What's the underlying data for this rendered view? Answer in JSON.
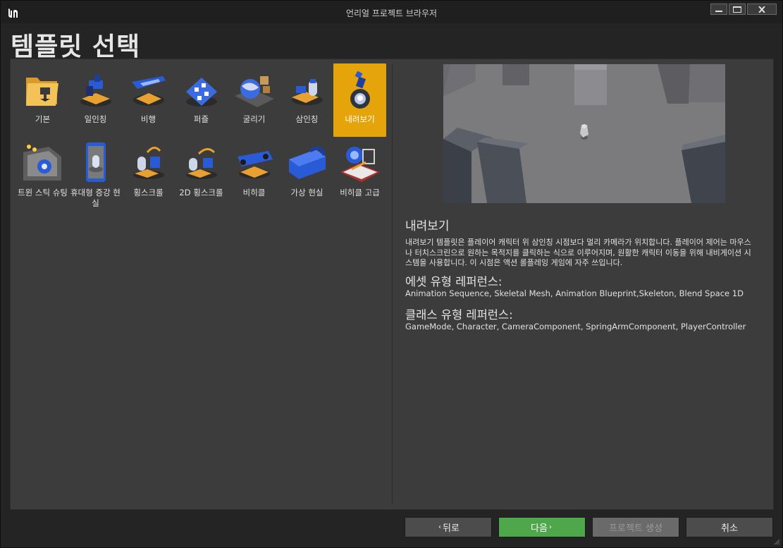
{
  "window": {
    "title": "언리얼 프로젝트 브라우저"
  },
  "heading": "템플릿 선택",
  "templates": [
    {
      "label": "기본",
      "icon": "folder-icon"
    },
    {
      "label": "일인칭",
      "icon": "first-person-icon"
    },
    {
      "label": "비행",
      "icon": "flying-icon"
    },
    {
      "label": "퍼즐",
      "icon": "puzzle-icon"
    },
    {
      "label": "굴리기",
      "icon": "rolling-icon"
    },
    {
      "label": "삼인칭",
      "icon": "third-person-icon"
    },
    {
      "label": "내려보기",
      "icon": "top-down-icon",
      "selected": true
    },
    {
      "label": "트윈 스틱 슈팅",
      "icon": "twin-stick-icon"
    },
    {
      "label": "휴대형 증강 현실",
      "icon": "handheld-ar-icon"
    },
    {
      "label": "횡스크롤",
      "icon": "side-scroller-icon"
    },
    {
      "label": "2D 횡스크롤",
      "icon": "side-scroller-2d-icon"
    },
    {
      "label": "비히클",
      "icon": "vehicle-icon"
    },
    {
      "label": "가상 현실",
      "icon": "vr-headset-icon"
    },
    {
      "label": "비히클 고급",
      "icon": "vehicle-advanced-icon"
    }
  ],
  "detail": {
    "title": "내려보기",
    "description": "내려보기 템플릿은 플레이어 캐릭터 위 삼인칭 시점보다 멀리 카메라가 위치합니다. 플레이어 제어는 마우스나 터치스크린으로 원하는 목적지를 클릭하는 식으로 이루어지며, 원활한 캐릭터 이동을 위해 내비게이션 시스템을 사용합니다. 이 시점은 액션 롤플레잉 게임에 자주 쓰입니다.",
    "asset_title": "에셋 유형 레퍼런스:",
    "asset_list": "Animation Sequence, Skeletal Mesh, Animation Blueprint,Skeleton, Blend Space 1D",
    "class_title": "클래스 유형 레퍼런스:",
    "class_list": "GameMode, Character, CameraComponent, SpringArmComponent, PlayerController"
  },
  "buttons": {
    "back": "뒤로",
    "next": "다음",
    "create": "프로젝트 생성",
    "cancel": "취소"
  },
  "colors": {
    "selected_tile": "#e5a40a",
    "next_button": "#4fa74b",
    "icon_blue": "#2a5bd7",
    "icon_orange": "#e8a030"
  }
}
